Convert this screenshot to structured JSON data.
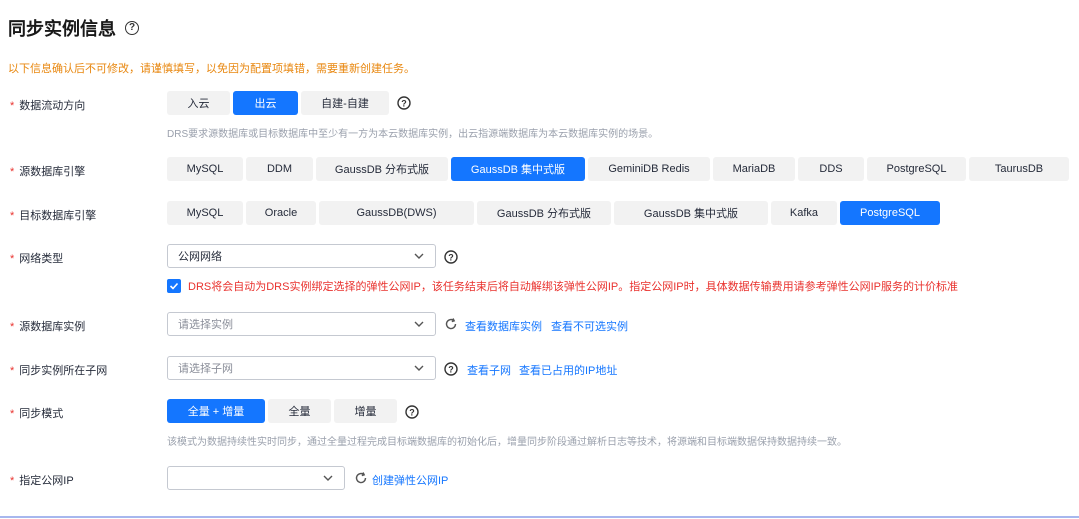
{
  "header": {
    "title": "同步实例信息",
    "help_icon": "help-icon"
  },
  "warning": "以下信息确认后不可修改，请谨慎填写，以免因为配置项填错，需要重新创建任务。",
  "flow_direction": {
    "label": "数据流动方向",
    "options": [
      "入云",
      "出云",
      "自建-自建"
    ],
    "selected": "出云",
    "hint": "DRS要求源数据库或目标数据库中至少有一方为本云数据库实例，出云指源端数据库为本云数据库实例的场景。"
  },
  "source_engine": {
    "label": "源数据库引擎",
    "options": [
      "MySQL",
      "DDM",
      "GaussDB 分布式版",
      "GaussDB 集中式版",
      "GeminiDB Redis",
      "MariaDB",
      "DDS",
      "PostgreSQL",
      "TaurusDB"
    ],
    "selected": "GaussDB 集中式版"
  },
  "target_engine": {
    "label": "目标数据库引擎",
    "options": [
      "MySQL",
      "Oracle",
      "GaussDB(DWS)",
      "GaussDB 分布式版",
      "GaussDB 集中式版",
      "Kafka",
      "PostgreSQL"
    ],
    "selected": "PostgreSQL"
  },
  "network": {
    "label": "网络类型",
    "value": "公网网络",
    "checkbox_text": "DRS将会自动为DRS实例绑定选择的弹性公网IP，该任务结束后将自动解绑该弹性公网IP。指定公网IP时，具体数据传输费用请参考弹性公网IP服务的计价标准",
    "checked": true
  },
  "source_instance": {
    "label": "源数据库实例",
    "placeholder": "请选择实例",
    "link1": "查看数据库实例",
    "link2": "查看不可选实例"
  },
  "subnet": {
    "label": "同步实例所在子网",
    "placeholder": "请选择子网",
    "link1": "查看子网",
    "link2": "查看已占用的IP地址"
  },
  "sync_mode": {
    "label": "同步模式",
    "options": [
      "全量 + 增量",
      "全量",
      "增量"
    ],
    "selected": "全量 + 增量",
    "hint": "该模式为数据持续性实时同步，通过全量过程完成目标端数据库的初始化后，增量同步阶段通过解析日志等技术，将源端和目标端数据保持数据持续一致。"
  },
  "public_ip": {
    "label": "指定公网IP",
    "value": "",
    "link": "创建弹性公网IP"
  },
  "colors": {
    "primary": "#1476ff",
    "warning": "#e8870f",
    "error": "#e9322e",
    "required": "#e9322e"
  }
}
